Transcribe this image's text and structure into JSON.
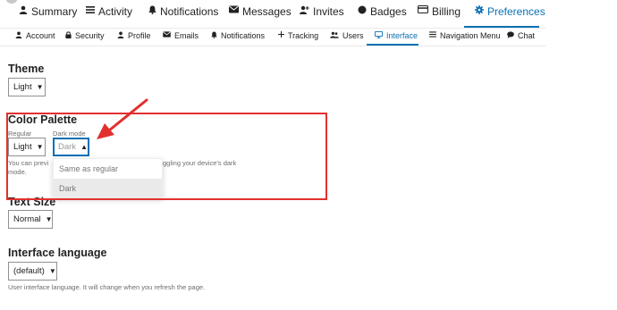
{
  "nav_primary": {
    "tabs": [
      {
        "label": "Summary",
        "icon": "user-icon"
      },
      {
        "label": "Activity",
        "icon": "list-icon"
      },
      {
        "label": "Notifications",
        "icon": "bell-icon"
      },
      {
        "label": "Messages",
        "icon": "envelope-icon"
      },
      {
        "label": "Invites",
        "icon": "user-plus-icon"
      },
      {
        "label": "Badges",
        "icon": "badge-icon"
      },
      {
        "label": "Billing",
        "icon": "credit-card-icon"
      },
      {
        "label": "Preferences",
        "icon": "gear-icon",
        "active": true
      }
    ]
  },
  "nav_secondary": {
    "tabs": [
      {
        "label": "Account",
        "icon": "user-icon"
      },
      {
        "label": "Security",
        "icon": "lock-icon"
      },
      {
        "label": "Profile",
        "icon": "user-icon"
      },
      {
        "label": "Emails",
        "icon": "envelope-icon"
      },
      {
        "label": "Notifications",
        "icon": "bell-icon"
      },
      {
        "label": "Tracking",
        "icon": "plus-icon"
      },
      {
        "label": "Users",
        "icon": "users-icon"
      },
      {
        "label": "Interface",
        "icon": "desktop-icon",
        "active": true
      },
      {
        "label": "Navigation Menu",
        "icon": "bars-icon"
      },
      {
        "label": "Chat",
        "icon": "comment-icon"
      }
    ]
  },
  "theme": {
    "heading": "Theme",
    "value": "Light"
  },
  "color_palette": {
    "heading": "Color Palette",
    "regular_label": "Regular",
    "regular_value": "Light",
    "dark_label": "Dark mode",
    "dark_value": "Dark",
    "help_line1": "You can previ",
    "help_line1_right": "ggling your device's dark",
    "help_line2": "mode.",
    "dropdown_options": [
      "Same as regular",
      "Dark"
    ],
    "dropdown_highlighted": "Dark"
  },
  "text_size": {
    "heading": "Text Size",
    "value": "Normal"
  },
  "interface_language": {
    "heading": "Interface language",
    "value": "(default)",
    "help": "User interface language. It will change when you refresh the page."
  },
  "annotation": {
    "box_color": "#e2302f",
    "arrow_color": "#e2302f"
  },
  "colors": {
    "accent": "#0a70b4",
    "text": "#222222",
    "muted": "#6d6d6d"
  }
}
